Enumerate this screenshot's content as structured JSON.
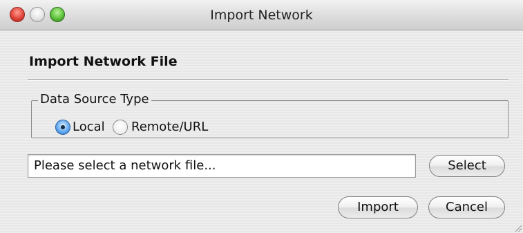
{
  "window": {
    "title": "Import Network"
  },
  "header": {
    "heading": "Import Network File"
  },
  "data_source": {
    "legend": "Data Source Type",
    "options": [
      {
        "label": "Local",
        "selected": true
      },
      {
        "label": "Remote/URL",
        "selected": false
      }
    ]
  },
  "file": {
    "value": "Please select a network file...",
    "select_label": "Select"
  },
  "actions": {
    "import_label": "Import",
    "cancel_label": "Cancel"
  },
  "colors": {
    "accent_radio": "#63aaf0",
    "close_button": "#e0453a",
    "zoom_button": "#5cc13a"
  },
  "icons": {
    "close": "close-traffic-light-icon",
    "minimize": "minimize-traffic-light-icon",
    "zoom": "zoom-traffic-light-icon",
    "resize": "resize-grip-icon"
  }
}
